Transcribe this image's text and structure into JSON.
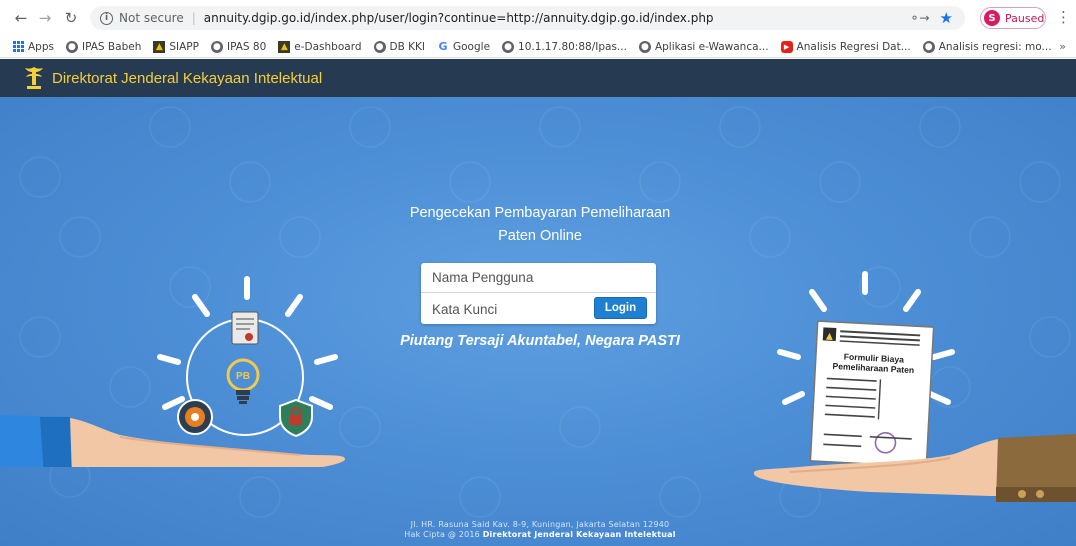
{
  "browser": {
    "status": "Not secure",
    "url": "annuity.dgip.go.id/index.php/user/login?continue=http://annuity.dgip.go.id/index.php",
    "profile_initial": "S",
    "profile_status": "Paused",
    "bookmarks": [
      {
        "icon": "apps-icon",
        "label": "Apps"
      },
      {
        "icon": "globe-icon",
        "label": "IPAS Babeh"
      },
      {
        "icon": "siapp-logo-icon",
        "label": "SIAPP"
      },
      {
        "icon": "globe-icon",
        "label": "IPAS 80"
      },
      {
        "icon": "dashboard-logo-icon",
        "label": "e-Dashboard"
      },
      {
        "icon": "globe-icon",
        "label": "DB KKI"
      },
      {
        "icon": "google-icon",
        "label": "Google"
      },
      {
        "icon": "globe-icon",
        "label": "10.1.17.80:88/Ipas..."
      },
      {
        "icon": "globe-icon",
        "label": "Aplikasi e-Wawanca..."
      },
      {
        "icon": "youtube-icon",
        "label": "Analisis Regresi Dat..."
      },
      {
        "icon": "globe-icon",
        "label": "Analisis regresi: mo..."
      }
    ],
    "more": "»"
  },
  "site": {
    "title": "Direktorat Jenderal Kekayaan Intelektual"
  },
  "login": {
    "headline_line1": "Pengecekan Pembayaran Pemeliharaan",
    "headline_line2": "Paten Online",
    "username_placeholder": "Nama Pengguna",
    "password_placeholder": "Kata Kunci",
    "button": "Login",
    "tagline": "Piutang Tersaji Akuntabel, Negara PASTI"
  },
  "illustration_right": {
    "doc_title_line1": "Formulir Biaya",
    "doc_title_line2": "Pemeliharaan Paten"
  },
  "illustration_left": {
    "bulb_text": "PB"
  },
  "footer": {
    "address": "Jl. HR. Rasuna Said Kav. 8-9, Kuningan, Jakarta Selatan 12940",
    "copyright_prefix": "Hak Cipta @ 2016 ",
    "copyright_org": "Direktorat Jenderal Kekayaan Intelektual"
  },
  "colors": {
    "header_bg": "#263a51",
    "title_yellow": "#f3cf3a",
    "page_blue": "#4d8fd6",
    "button_blue": "#1f7fd0"
  }
}
